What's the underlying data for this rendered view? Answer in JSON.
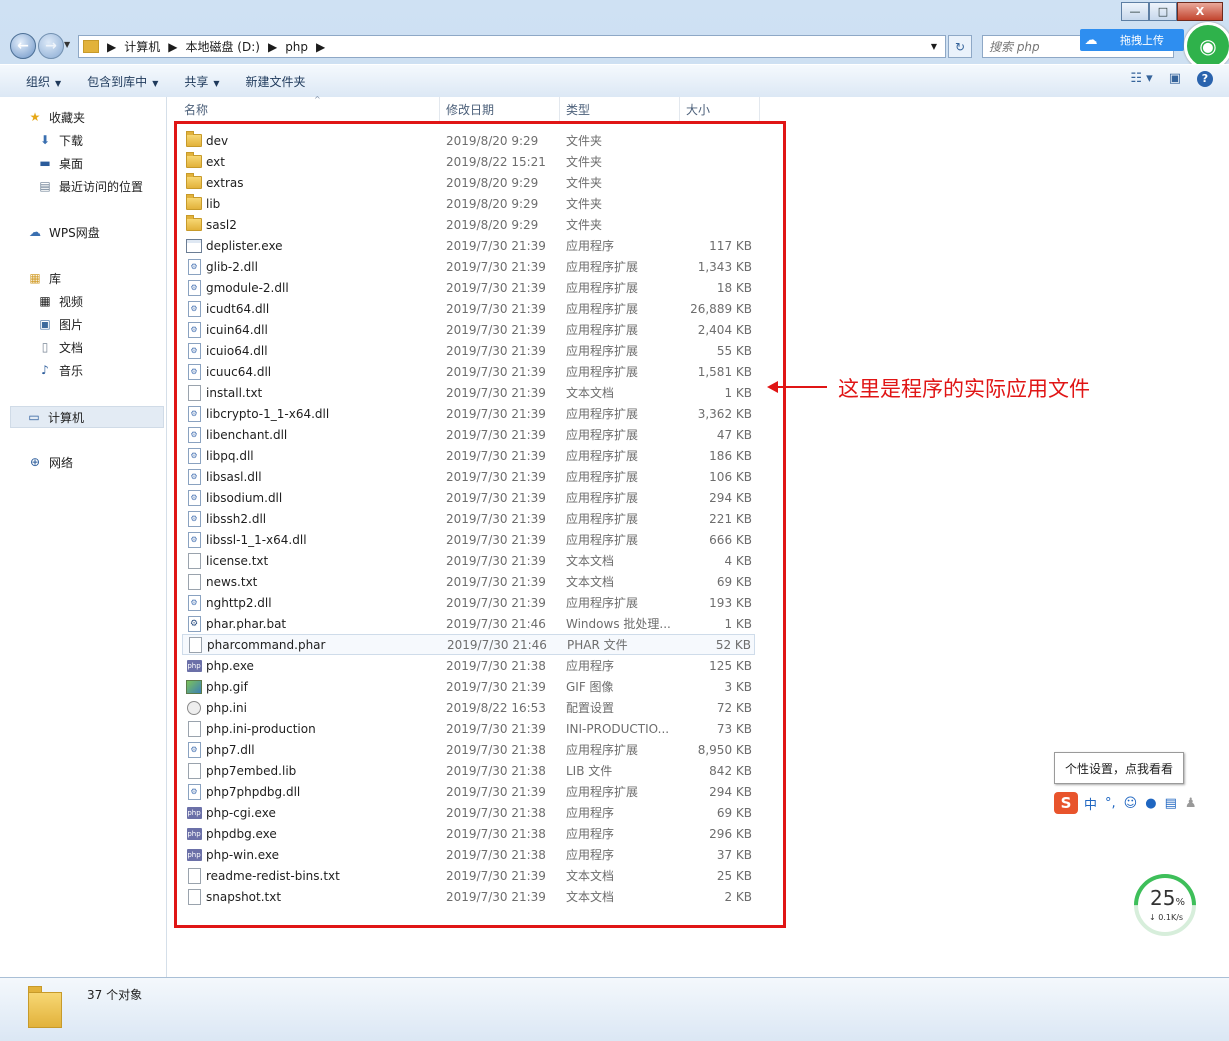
{
  "window": {
    "minimize": "—",
    "maximize": "□",
    "close": "X"
  },
  "nav": {
    "back_icon": "arrow-left-icon",
    "forward_icon": "arrow-right-icon",
    "breadcrumb": [
      "计算机",
      "本地磁盘 (D:)",
      "php"
    ],
    "search_placeholder": "搜索 php",
    "upload_label": "拖拽上传"
  },
  "toolbar": {
    "organize": "组织",
    "include": "包含到库中",
    "share": "共享",
    "new_folder": "新建文件夹"
  },
  "sidebar": {
    "favorites": "收藏夹",
    "downloads": "下载",
    "desktop": "桌面",
    "recent": "最近访问的位置",
    "wps": "WPS网盘",
    "libraries": "库",
    "videos": "视频",
    "pictures": "图片",
    "documents": "文档",
    "music": "音乐",
    "computer": "计算机",
    "network": "网络"
  },
  "columns": {
    "name": "名称",
    "date": "修改日期",
    "type": "类型",
    "size": "大小"
  },
  "files": [
    {
      "name": "dev",
      "date": "2019/8/20 9:29",
      "type": "文件夹",
      "size": "",
      "icon": "folder"
    },
    {
      "name": "ext",
      "date": "2019/8/22 15:21",
      "type": "文件夹",
      "size": "",
      "icon": "folder"
    },
    {
      "name": "extras",
      "date": "2019/8/20 9:29",
      "type": "文件夹",
      "size": "",
      "icon": "folder"
    },
    {
      "name": "lib",
      "date": "2019/8/20 9:29",
      "type": "文件夹",
      "size": "",
      "icon": "folder"
    },
    {
      "name": "sasl2",
      "date": "2019/8/20 9:29",
      "type": "文件夹",
      "size": "",
      "icon": "folder"
    },
    {
      "name": "deplister.exe",
      "date": "2019/7/30 21:39",
      "type": "应用程序",
      "size": "117 KB",
      "icon": "exe"
    },
    {
      "name": "glib-2.dll",
      "date": "2019/7/30 21:39",
      "type": "应用程序扩展",
      "size": "1,343 KB",
      "icon": "dll"
    },
    {
      "name": "gmodule-2.dll",
      "date": "2019/7/30 21:39",
      "type": "应用程序扩展",
      "size": "18 KB",
      "icon": "dll"
    },
    {
      "name": "icudt64.dll",
      "date": "2019/7/30 21:39",
      "type": "应用程序扩展",
      "size": "26,889 KB",
      "icon": "dll"
    },
    {
      "name": "icuin64.dll",
      "date": "2019/7/30 21:39",
      "type": "应用程序扩展",
      "size": "2,404 KB",
      "icon": "dll"
    },
    {
      "name": "icuio64.dll",
      "date": "2019/7/30 21:39",
      "type": "应用程序扩展",
      "size": "55 KB",
      "icon": "dll"
    },
    {
      "name": "icuuc64.dll",
      "date": "2019/7/30 21:39",
      "type": "应用程序扩展",
      "size": "1,581 KB",
      "icon": "dll"
    },
    {
      "name": "install.txt",
      "date": "2019/7/30 21:39",
      "type": "文本文档",
      "size": "1 KB",
      "icon": "txt"
    },
    {
      "name": "libcrypto-1_1-x64.dll",
      "date": "2019/7/30 21:39",
      "type": "应用程序扩展",
      "size": "3,362 KB",
      "icon": "dll"
    },
    {
      "name": "libenchant.dll",
      "date": "2019/7/30 21:39",
      "type": "应用程序扩展",
      "size": "47 KB",
      "icon": "dll"
    },
    {
      "name": "libpq.dll",
      "date": "2019/7/30 21:39",
      "type": "应用程序扩展",
      "size": "186 KB",
      "icon": "dll"
    },
    {
      "name": "libsasl.dll",
      "date": "2019/7/30 21:39",
      "type": "应用程序扩展",
      "size": "106 KB",
      "icon": "dll"
    },
    {
      "name": "libsodium.dll",
      "date": "2019/7/30 21:39",
      "type": "应用程序扩展",
      "size": "294 KB",
      "icon": "dll"
    },
    {
      "name": "libssh2.dll",
      "date": "2019/7/30 21:39",
      "type": "应用程序扩展",
      "size": "221 KB",
      "icon": "dll"
    },
    {
      "name": "libssl-1_1-x64.dll",
      "date": "2019/7/30 21:39",
      "type": "应用程序扩展",
      "size": "666 KB",
      "icon": "dll"
    },
    {
      "name": "license.txt",
      "date": "2019/7/30 21:39",
      "type": "文本文档",
      "size": "4 KB",
      "icon": "txt"
    },
    {
      "name": "news.txt",
      "date": "2019/7/30 21:39",
      "type": "文本文档",
      "size": "69 KB",
      "icon": "txt"
    },
    {
      "name": "nghttp2.dll",
      "date": "2019/7/30 21:39",
      "type": "应用程序扩展",
      "size": "193 KB",
      "icon": "dll"
    },
    {
      "name": "phar.phar.bat",
      "date": "2019/7/30 21:46",
      "type": "Windows 批处理...",
      "size": "1 KB",
      "icon": "bat"
    },
    {
      "name": "pharcommand.phar",
      "date": "2019/7/30 21:46",
      "type": "PHAR 文件",
      "size": "52 KB",
      "icon": "txt",
      "highlight": true
    },
    {
      "name": "php.exe",
      "date": "2019/7/30 21:38",
      "type": "应用程序",
      "size": "125 KB",
      "icon": "php"
    },
    {
      "name": "php.gif",
      "date": "2019/7/30 21:39",
      "type": "GIF 图像",
      "size": "3 KB",
      "icon": "gif"
    },
    {
      "name": "php.ini",
      "date": "2019/8/22 16:53",
      "type": "配置设置",
      "size": "72 KB",
      "icon": "ini"
    },
    {
      "name": "php.ini-production",
      "date": "2019/7/30 21:39",
      "type": "INI-PRODUCTIO...",
      "size": "73 KB",
      "icon": "txt"
    },
    {
      "name": "php7.dll",
      "date": "2019/7/30 21:38",
      "type": "应用程序扩展",
      "size": "8,950 KB",
      "icon": "dll"
    },
    {
      "name": "php7embed.lib",
      "date": "2019/7/30 21:38",
      "type": "LIB 文件",
      "size": "842 KB",
      "icon": "txt"
    },
    {
      "name": "php7phpdbg.dll",
      "date": "2019/7/30 21:39",
      "type": "应用程序扩展",
      "size": "294 KB",
      "icon": "dll"
    },
    {
      "name": "php-cgi.exe",
      "date": "2019/7/30 21:38",
      "type": "应用程序",
      "size": "69 KB",
      "icon": "php"
    },
    {
      "name": "phpdbg.exe",
      "date": "2019/7/30 21:38",
      "type": "应用程序",
      "size": "296 KB",
      "icon": "php"
    },
    {
      "name": "php-win.exe",
      "date": "2019/7/30 21:38",
      "type": "应用程序",
      "size": "37 KB",
      "icon": "php"
    },
    {
      "name": "readme-redist-bins.txt",
      "date": "2019/7/30 21:39",
      "type": "文本文档",
      "size": "25 KB",
      "icon": "txt"
    },
    {
      "name": "snapshot.txt",
      "date": "2019/7/30 21:39",
      "type": "文本文档",
      "size": "2 KB",
      "icon": "txt"
    }
  ],
  "annotation": {
    "text": "这里是程序的实际应用文件",
    "color": "#e01515"
  },
  "status": {
    "count": "37 个对象"
  },
  "ime": {
    "tip": "个性设置，点我看看",
    "zh": "中",
    "punct": "°,"
  },
  "speed": {
    "percent": "25",
    "unit": "%",
    "rate": "↓ 0.1K/s"
  }
}
